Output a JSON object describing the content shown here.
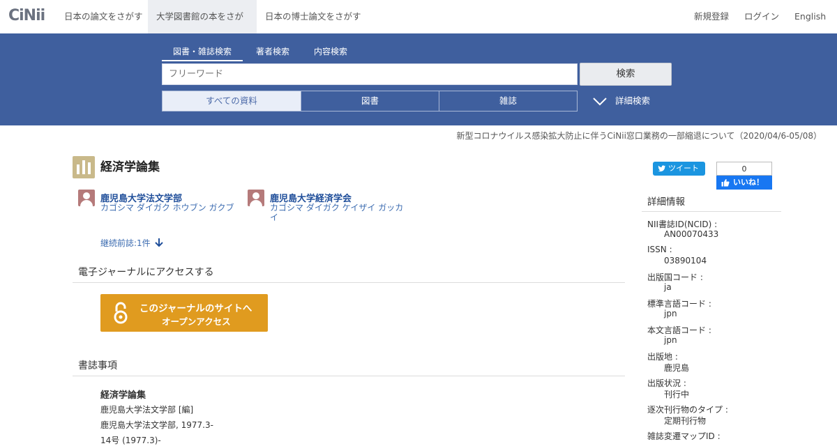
{
  "header": {
    "logo": "CiNii",
    "nav": [
      {
        "label": "日本の論文をさがす"
      },
      {
        "label": "大学図書館の本をさがす"
      },
      {
        "label": "日本の博士論文をさがす"
      }
    ],
    "right": {
      "register": "新規登録",
      "login": "ログイン",
      "language": "English"
    }
  },
  "search": {
    "tabs": [
      {
        "label": "図書・雑誌検索"
      },
      {
        "label": "著者検索"
      },
      {
        "label": "内容検索"
      }
    ],
    "placeholder": "フリーワード",
    "button": "検索",
    "filters": [
      {
        "label": "すべての資料"
      },
      {
        "label": "図書"
      },
      {
        "label": "雑誌"
      }
    ],
    "advanced": "詳細検索"
  },
  "notice": "新型コロナウイルス感染拡大防止に伴うCiNii窓口業務の一部縮退について（2020/04/6-05/08）",
  "record": {
    "title": "経済学論集",
    "authors": [
      {
        "name": "鹿児島大学法文学部",
        "kana": "カゴシマ ダイガク ホウブン ガクブ"
      },
      {
        "name": "鹿児島大学経済学会",
        "kana": "カゴシマ ダイガク ケイザイ ガッカイ"
      }
    ],
    "prev_link": "継続前誌:1件",
    "ejournal_heading": "電子ジャーナルにアクセスする",
    "oa_button": {
      "line1": "このジャーナルのサイトへ",
      "line2": "オープンアクセス"
    },
    "bib_heading": "書誌事項",
    "bib": {
      "title": "経済学論集",
      "responsibility": "鹿児島大学法文学部 [編]",
      "publication": "鹿児島大学法文学部, 1977.3-",
      "volume": "14号 (1977.3)-"
    }
  },
  "social": {
    "tweet": "ツイート",
    "fb_count": "0",
    "fb_like": "いいね！"
  },
  "details": {
    "heading": "詳細情報",
    "items": [
      {
        "label": "NII書誌ID(NCID) :",
        "value": "AN00070433"
      },
      {
        "label": "ISSN :",
        "value": "03890104"
      },
      {
        "label": "出版国コード :",
        "value": "ja"
      },
      {
        "label": "標準言語コード :",
        "value": "jpn"
      },
      {
        "label": "本文言語コード :",
        "value": "jpn"
      },
      {
        "label": "出版地 :",
        "value": "鹿児島"
      },
      {
        "label": "出版状況 :",
        "value": "刊行中"
      },
      {
        "label": "逐次刊行物のタイプ :",
        "value": "定期刊行物"
      },
      {
        "label": "雑誌変遷マップID :",
        "value": ""
      }
    ]
  }
}
